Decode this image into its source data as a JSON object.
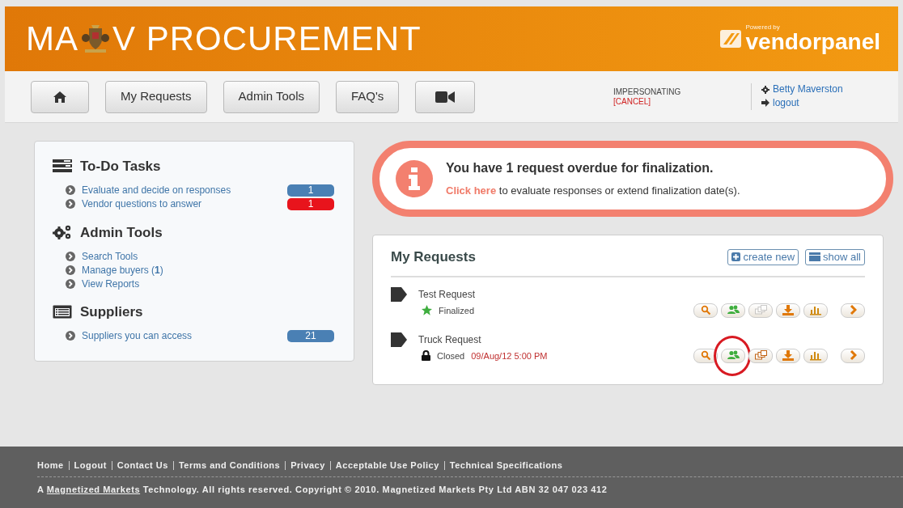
{
  "header": {
    "logo_left": "MA",
    "logo_right": "V PROCUREMENT",
    "powered_by": "Powered by",
    "brand": "vendorpanel"
  },
  "nav": {
    "buttons": [
      {
        "kind": "home"
      },
      {
        "kind": "text",
        "label": "My Requests"
      },
      {
        "kind": "text",
        "label": "Admin Tools"
      },
      {
        "kind": "text",
        "label": "FAQ's"
      },
      {
        "kind": "video"
      }
    ],
    "impersonating": "IMPERSONATING",
    "cancel": "[CANCEL]",
    "user": "Betty Maverston",
    "logout": "logout"
  },
  "sidebar": {
    "sections": [
      {
        "kind": "tasks",
        "title": "To-Do Tasks",
        "items": [
          {
            "label": "Evaluate and decide on responses",
            "count": "1",
            "color": "#4a80b4"
          },
          {
            "label": "Vendor questions to answer",
            "count": "1",
            "color": "#e8141c"
          }
        ]
      },
      {
        "kind": "admin",
        "title": "Admin Tools",
        "items": [
          {
            "label": "Search Tools"
          },
          {
            "label": "Manage buyers (**1**)"
          },
          {
            "label": "View Reports"
          }
        ]
      },
      {
        "kind": "suppliers",
        "title": "Suppliers",
        "items": [
          {
            "label": "Suppliers you can access",
            "count": "21",
            "color": "#4a80b4"
          }
        ]
      }
    ]
  },
  "alert": {
    "title": "You have 1 request overdue for finalization.",
    "link": "Click here",
    "text": "to evaluate responses or extend finalization date(s)."
  },
  "requests": {
    "title": "My Requests",
    "create": "create new",
    "show_all": "show all",
    "rows": [
      {
        "name": "Test Request",
        "kind": "finalized",
        "status": "Finalized",
        "actions": [
          {
            "kind": "search",
            "disabled": false,
            "circled": false
          },
          {
            "kind": "people",
            "disabled": false,
            "circled": false
          },
          {
            "kind": "cards",
            "disabled": true,
            "circled": false
          },
          {
            "kind": "download",
            "disabled": false,
            "circled": false
          },
          {
            "kind": "chart",
            "disabled": false,
            "circled": false
          },
          {
            "kind": "next",
            "disabled": false,
            "circled": false
          }
        ]
      },
      {
        "name": "Truck Request",
        "kind": "closed",
        "status": "Closed",
        "date": "09/Aug/12 5:00 PM",
        "actions": [
          {
            "kind": "search",
            "disabled": false,
            "circled": false
          },
          {
            "kind": "people",
            "disabled": false,
            "circled": true
          },
          {
            "kind": "cards",
            "disabled": false,
            "circled": false
          },
          {
            "kind": "download",
            "disabled": false,
            "circled": false
          },
          {
            "kind": "chart",
            "disabled": false,
            "circled": false
          },
          {
            "kind": "next",
            "disabled": false,
            "circled": false
          }
        ]
      }
    ]
  },
  "footer": {
    "links": [
      "Home",
      "Logout",
      "Contact Us",
      "Terms and Conditions",
      "Privacy",
      "Acceptable Use Policy",
      "Technical Specifications"
    ],
    "copyright_prefix": "A",
    "copyright_link": "Magnetized Markets",
    "copyright_suffix": "Technology. All rights reserved. Copyright © 2010. Magnetized Markets Pty Ltd ABN 32 047 023 412"
  }
}
